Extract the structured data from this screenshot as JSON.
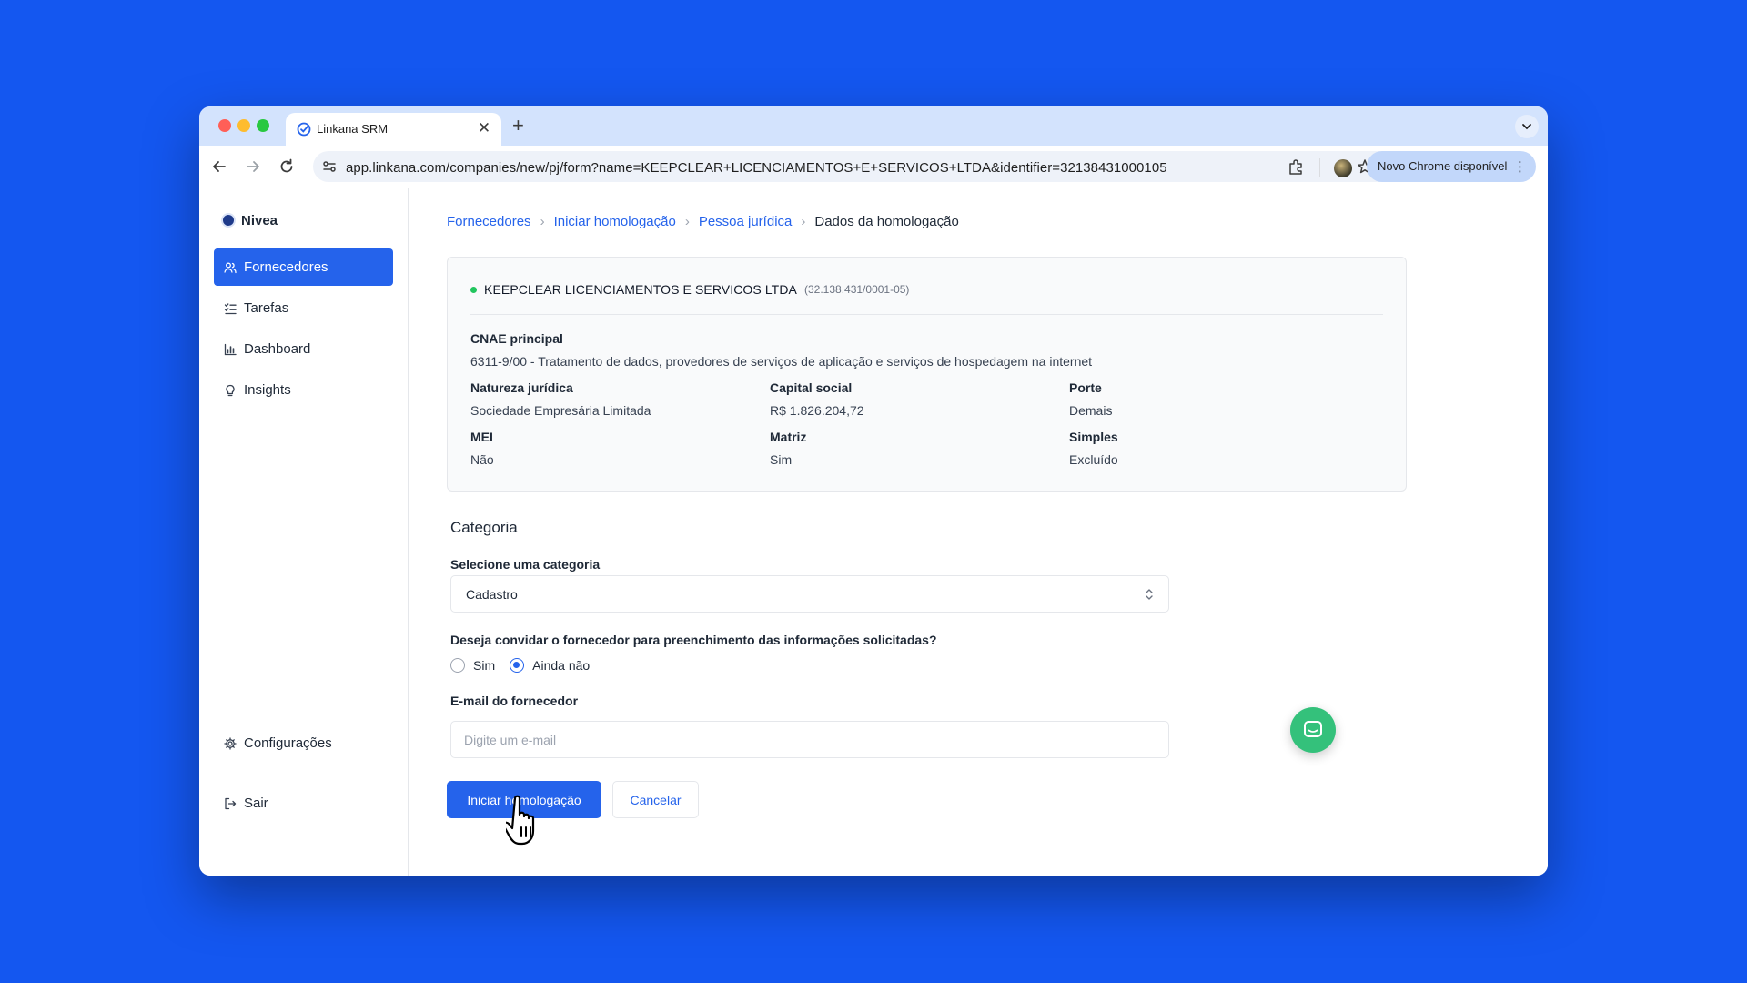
{
  "browser": {
    "tab_title": "Linkana SRM",
    "tab_close": "✕",
    "new_tab": "+",
    "url": "app.linkana.com/companies/new/pj/form?name=KEEPCLEAR+LICENCIAMENTOS+E+SERVICOS+LTDA&identifier=32138431000105",
    "update_label": "Novo Chrome disponível",
    "update_menu": "⋮"
  },
  "sidebar": {
    "org_name": "Nivea",
    "items": [
      {
        "label": "Fornecedores",
        "icon": "users-icon",
        "active": true
      },
      {
        "label": "Tarefas",
        "icon": "list-check-icon",
        "active": false
      },
      {
        "label": "Dashboard",
        "icon": "bar-chart-icon",
        "active": false
      },
      {
        "label": "Insights",
        "icon": "lightbulb-icon",
        "active": false
      }
    ],
    "bottom": [
      {
        "label": "Configurações",
        "icon": "gear-icon"
      },
      {
        "label": "Sair",
        "icon": "logout-icon"
      }
    ]
  },
  "breadcrumb": {
    "items": [
      "Fornecedores",
      "Iniciar homologação",
      "Pessoa jurídica"
    ],
    "current": "Dados da homologação"
  },
  "company": {
    "name": "KEEPCLEAR LICENCIAMENTOS E SERVICOS LTDA",
    "cnpj": "(32.138.431/0001-05)",
    "cnae_label": "CNAE principal",
    "cnae_value": "6311-9/00 - Tratamento de dados, provedores de serviços de aplicação e serviços de hospedagem na internet",
    "fields": {
      "natureza": {
        "label": "Natureza jurídica",
        "value": "Sociedade Empresária Limitada"
      },
      "capital": {
        "label": "Capital social",
        "value": "R$ 1.826.204,72"
      },
      "porte": {
        "label": "Porte",
        "value": "Demais"
      },
      "mei": {
        "label": "MEI",
        "value": "Não"
      },
      "matriz": {
        "label": "Matriz",
        "value": "Sim"
      },
      "simples": {
        "label": "Simples",
        "value": "Excluído"
      }
    }
  },
  "form": {
    "section_title": "Categoria",
    "category_label": "Selecione uma categoria",
    "category_value": "Cadastro",
    "invite_question": "Deseja convidar o fornecedor para preenchimento das informações solicitadas?",
    "radio_yes": "Sim",
    "radio_no": "Ainda não",
    "radio_selected": "Ainda não",
    "email_label": "E-mail do fornecedor",
    "email_placeholder": "Digite um e-mail",
    "email_value": "",
    "submit_label": "Iniciar homologação",
    "cancel_label": "Cancelar"
  },
  "colors": {
    "background": "#1457f0",
    "accent": "#2563eb",
    "status_active": "#22c55e",
    "chat_fab": "#34c17b"
  }
}
